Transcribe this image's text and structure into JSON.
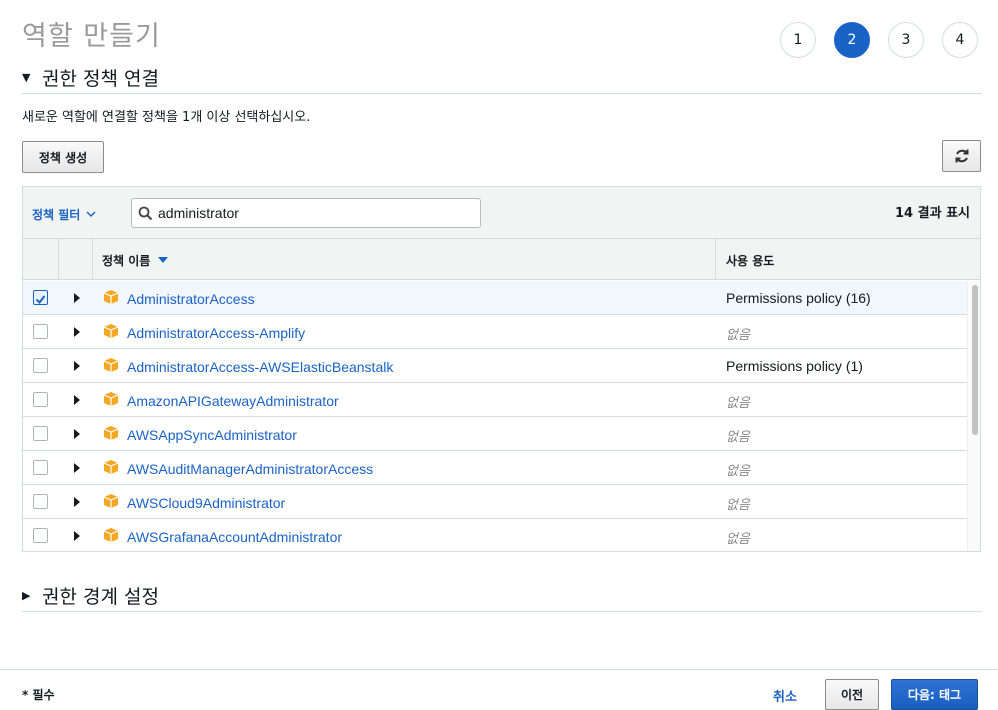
{
  "page": {
    "title": "역할 만들기"
  },
  "steps": [
    "1",
    "2",
    "3",
    "4"
  ],
  "active_step": "2",
  "section_permissions": {
    "title": "권한 정책 연결",
    "description": "새로운 역할에 연결할 정책을 1개 이상 선택하십시오.",
    "create_policy_label": "정책 생성",
    "refresh_icon": "refresh-icon"
  },
  "filter": {
    "label": "정책 필터",
    "search_value": "administrator",
    "result_count": "14 결과 표시"
  },
  "table": {
    "columns": {
      "name": "정책 이름",
      "usage": "사용 용도"
    },
    "rows": [
      {
        "name": "AdministratorAccess",
        "usage": "Permissions policy (16)",
        "checked": true
      },
      {
        "name": "AdministratorAccess-Amplify",
        "usage": "없음",
        "checked": false
      },
      {
        "name": "AdministratorAccess-AWSElasticBeanstalk",
        "usage": "Permissions policy (1)",
        "checked": false
      },
      {
        "name": "AmazonAPIGatewayAdministrator",
        "usage": "없음",
        "checked": false
      },
      {
        "name": "AWSAppSyncAdministrator",
        "usage": "없음",
        "checked": false
      },
      {
        "name": "AWSAuditManagerAdministratorAccess",
        "usage": "없음",
        "checked": false
      },
      {
        "name": "AWSCloud9Administrator",
        "usage": "없음",
        "checked": false
      },
      {
        "name": "AWSGrafanaAccountAdministrator",
        "usage": "없음",
        "checked": false
      }
    ]
  },
  "section_boundary": {
    "title": "권한 경계 설정"
  },
  "footer": {
    "required": "* 필수",
    "cancel": "취소",
    "previous": "이전",
    "next": "다음: 태그"
  },
  "colors": {
    "accent": "#1a63c6",
    "policy_icon": "#f5a623"
  }
}
